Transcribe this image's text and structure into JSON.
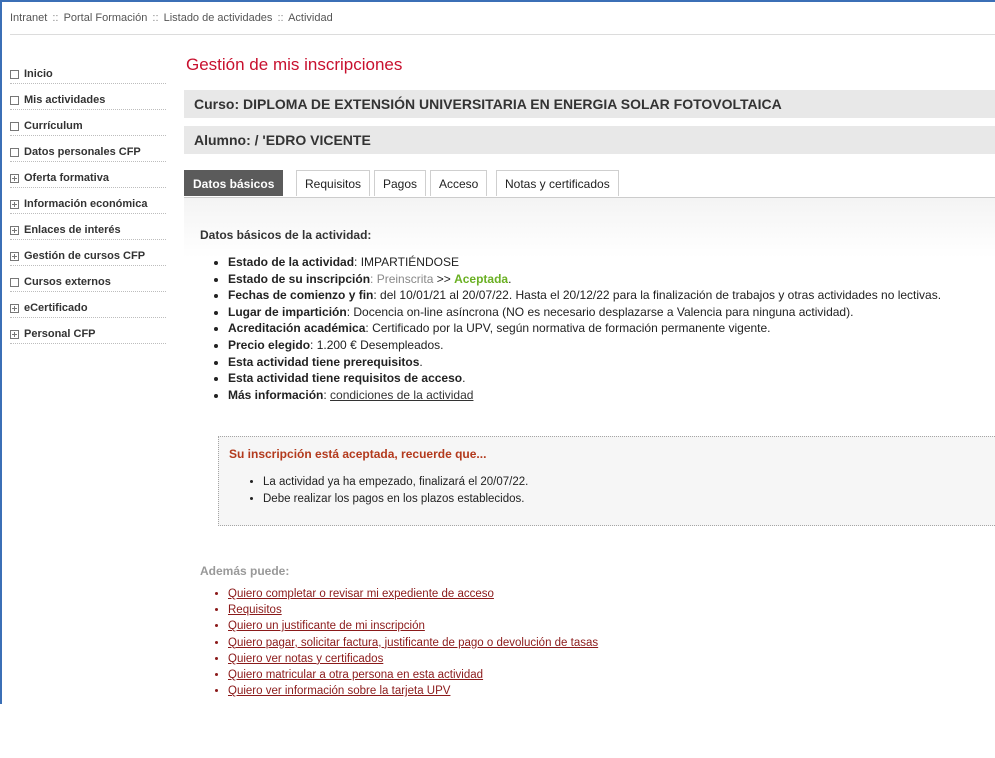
{
  "breadcrumb": {
    "items": [
      "Intranet",
      "Portal Formación",
      "Listado de actividades",
      "Actividad"
    ],
    "separator": "::"
  },
  "sidebar": {
    "items": [
      {
        "label": "Inicio",
        "icon": "checkbox-icon"
      },
      {
        "label": "Mis actividades",
        "icon": "checkbox-icon"
      },
      {
        "label": "Currículum",
        "icon": "checkbox-icon"
      },
      {
        "label": "Datos personales CFP",
        "icon": "checkbox-icon"
      },
      {
        "label": "Oferta formativa",
        "icon": "expand-plus-icon"
      },
      {
        "label": "Información económica",
        "icon": "expand-plus-icon"
      },
      {
        "label": "Enlaces de interés",
        "icon": "expand-plus-icon"
      },
      {
        "label": "Gestión de cursos CFP",
        "icon": "expand-plus-icon"
      },
      {
        "label": "Cursos externos",
        "icon": "checkbox-icon"
      },
      {
        "label": "eCertificado",
        "icon": "expand-plus-icon"
      },
      {
        "label": "Personal CFP",
        "icon": "expand-plus-icon"
      }
    ]
  },
  "main": {
    "title": "Gestión de mis inscripciones",
    "course": "Curso: DIPLOMA DE EXTENSIÓN UNIVERSITARIA EN ENERGIA SOLAR FOTOVOLTAICA",
    "student": "Alumno: /                                    'EDRO VICENTE",
    "tabs": [
      {
        "label": "Datos básicos",
        "active": true
      },
      {
        "label": "Requisitos",
        "active": false
      },
      {
        "label": "Pagos",
        "active": false
      },
      {
        "label": "Acceso",
        "active": false
      },
      {
        "label": "Notas y certificados",
        "active": false
      }
    ],
    "basic": {
      "section_title": "Datos básicos de la actividad:",
      "estado_actividad_label": "Estado de la actividad",
      "estado_actividad_value": ": IMPARTIÉNDOSE",
      "estado_inscripcion_label": "Estado de su inscripción",
      "estado_inscripcion_prev": ": Preinscrita",
      "estado_inscripcion_arrow": " >> ",
      "estado_inscripcion_value": "Aceptada",
      "fechas_label": "Fechas de comienzo y fin",
      "fechas_value": ": del 10/01/21 al 20/07/22. Hasta el 20/12/22 para la finalización de trabajos y otras actividades no lectivas.",
      "lugar_label": "Lugar de impartición",
      "lugar_value": ": Docencia on-line asíncrona (NO es necesario desplazarse a Valencia para ninguna actividad).",
      "acreditacion_label": "Acreditación académica",
      "acreditacion_value": ": Certificado por la UPV, según normativa de formación permanente vigente.",
      "precio_label": "Precio elegido",
      "precio_value": ": 1.200 €  Desempleados.",
      "prerequisitos": "Esta actividad tiene prerequisitos",
      "requisitos_acceso": "Esta actividad tiene requisitos de acceso",
      "mas_info_label": "Más información",
      "mas_info_link": "condiciones de la actividad"
    },
    "notice": {
      "title": "Su inscripción está aceptada, recuerde que...",
      "items": [
        "La actividad ya ha empezado, finalizará el 20/07/22.",
        "Debe realizar los pagos en los plazos establecidos."
      ]
    },
    "more": {
      "title": "Además puede:",
      "links": [
        "Quiero completar o revisar mi expediente de acceso",
        "Requisitos",
        "Quiero un justificante de mi inscripción",
        "Quiero pagar, solicitar factura, justificante de pago o devolución de tasas",
        "Quiero ver notas y certificados",
        "Quiero matricular a otra persona en esta actividad",
        "Quiero ver información sobre la tarjeta UPV"
      ]
    }
  },
  "colors": {
    "title_red": "#c8102e",
    "accepted_green": "#6ab023",
    "link_maroon": "#8b1a1a",
    "notice_title": "#b33a1d",
    "active_tab": "#5b5b5b"
  }
}
